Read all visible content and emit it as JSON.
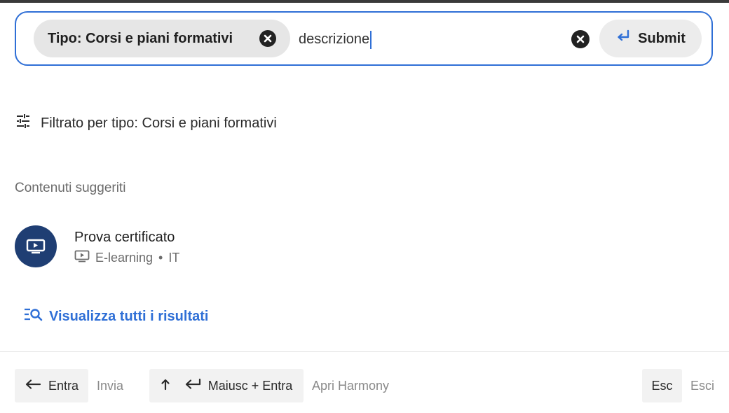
{
  "search": {
    "chip_label": "Tipo: Corsi e piani formativi",
    "query": "descrizione",
    "submit_label": "Submit"
  },
  "filter": {
    "text": "Filtrato per tipo: Corsi e piani formativi"
  },
  "suggested": {
    "title": "Contenuti suggeriti",
    "items": [
      {
        "title": "Prova certificato",
        "type": "E-learning",
        "separator": "•",
        "lang": "IT"
      }
    ]
  },
  "view_all_label": "Visualizza tutti i risultati",
  "shortcuts": {
    "enter_key": "Entra",
    "enter_hint": "Invia",
    "shift_enter_key": "Maiusc + Entra",
    "shift_enter_hint": "Apri Harmony",
    "esc_key": "Esc",
    "esc_hint": "Esci"
  },
  "colors": {
    "accent": "#2f6fd6",
    "avatar": "#1f3e73"
  }
}
